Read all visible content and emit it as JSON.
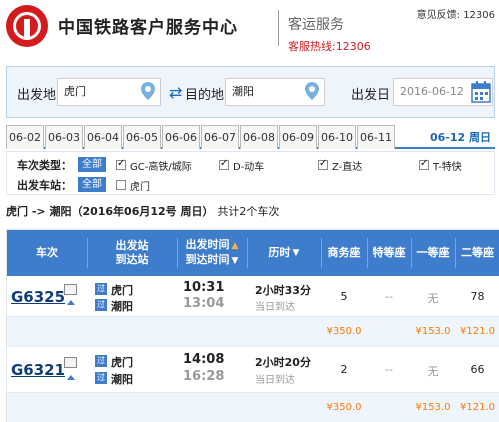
{
  "header": {
    "brand": "中国铁路客户服务中心",
    "section": "客运服务",
    "hotline": "客服热线:12306",
    "feedback": "意见反馈: 12306"
  },
  "search": {
    "from_label": "出发地",
    "from_value": "虎门",
    "to_label": "目的地",
    "to_value": "潮阳",
    "date_label": "出发日",
    "date_value": "2016-06-12"
  },
  "dates": {
    "tabs": [
      "06-02",
      "06-03",
      "06-04",
      "06-05",
      "06-06",
      "06-07",
      "06-08",
      "06-09",
      "06-10",
      "06-11"
    ],
    "current": "06-12 周日"
  },
  "filters": {
    "type_label": "车次类型：",
    "station_label": "出发车站：",
    "all_label": "全部",
    "types": [
      {
        "label": "GC-高铁/城际",
        "checked": true
      },
      {
        "label": "D-动车",
        "checked": true
      },
      {
        "label": "Z-直达",
        "checked": true
      },
      {
        "label": "T-特快",
        "checked": true
      }
    ],
    "stations": [
      {
        "label": "虎门",
        "checked": false
      }
    ]
  },
  "summary": {
    "route": "虎门 -> 潮阳（2016年06月12号  周日）",
    "count": "共计2个车次"
  },
  "table": {
    "headers": {
      "train": "车次",
      "stations_top": "出发站",
      "stations_bottom": "到达站",
      "times_top": "出发时间",
      "times_bottom": "到达时间",
      "duration": "历时",
      "business": "商务座",
      "premium": "特等座",
      "first": "一等座",
      "second": "二等座"
    },
    "rows": [
      {
        "train_no": "G6325",
        "from_badge": "过",
        "from": "虎门",
        "to_badge": "过",
        "to": "潮阳",
        "dep": "10:31",
        "arr": "13:04",
        "duration": "2小时33分",
        "arrive_note": "当日到达",
        "business": "5",
        "premium": "--",
        "first": "无",
        "second": "78",
        "price_business": "¥350.0",
        "price_first": "¥153.0",
        "price_second": "¥121.0"
      },
      {
        "train_no": "G6321",
        "from_badge": "过",
        "from": "虎门",
        "to_badge": "过",
        "to": "潮阳",
        "dep": "14:08",
        "arr": "16:28",
        "duration": "2小时20分",
        "arrive_note": "当日到达",
        "business": "2",
        "premium": "--",
        "first": "无",
        "second": "66",
        "price_business": "¥350.0",
        "price_first": "¥153.0",
        "price_second": "¥121.0"
      }
    ]
  },
  "colors": {
    "brand_red": "#d31b1d",
    "header_blue": "#3e7ccc",
    "price_orange": "#ff7a00",
    "link_blue": "#0f3d7a"
  },
  "chart_data": null
}
